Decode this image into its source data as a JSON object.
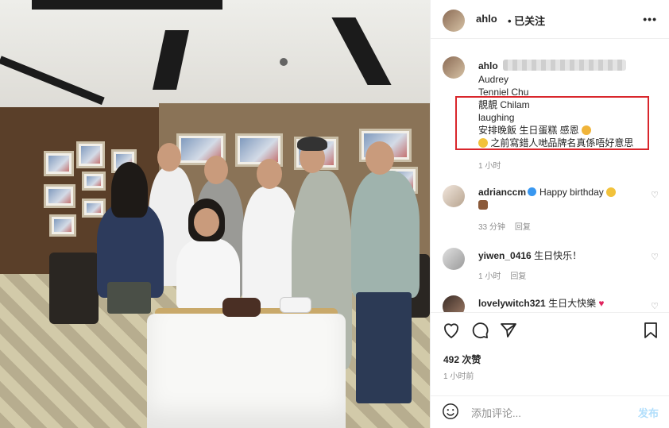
{
  "header": {
    "username": "ahlo",
    "follow_status": "• 已关注",
    "more": "•••"
  },
  "caption": {
    "username": "ahlo",
    "lines": [
      "Audrey",
      "Tenniel Chu",
      "靚靚 Chilam",
      "laughing",
      "安排晚飯 生日蛋糕 感恩",
      "之前寫錯人哋品牌名真係唔好意思"
    ],
    "time": "1 小时"
  },
  "comments": [
    {
      "username": "adrianccm",
      "verified": true,
      "text": "Happy birthday",
      "time": "33 分钟",
      "reply": "回复"
    },
    {
      "username": "yiwen_0416",
      "verified": false,
      "text": "生日快乐！",
      "time": "1 小时",
      "reply": "回复"
    },
    {
      "username": "lovelywitch321",
      "verified": false,
      "text": "生日大快樂",
      "time": "",
      "reply": ""
    }
  ],
  "stats": {
    "likes": "492 次赞",
    "posted": "1 小时前"
  },
  "comment_box": {
    "placeholder": "添加评论...",
    "post_label": "发布"
  },
  "colors": {
    "highlight_box": "#d9262c",
    "link_blue": "#3897f0",
    "post_disabled": "#b2dffc"
  },
  "icons": [
    "more-icon",
    "heart-icon",
    "comment-icon",
    "share-icon",
    "bookmark-icon",
    "smile-icon",
    "verified-icon"
  ]
}
